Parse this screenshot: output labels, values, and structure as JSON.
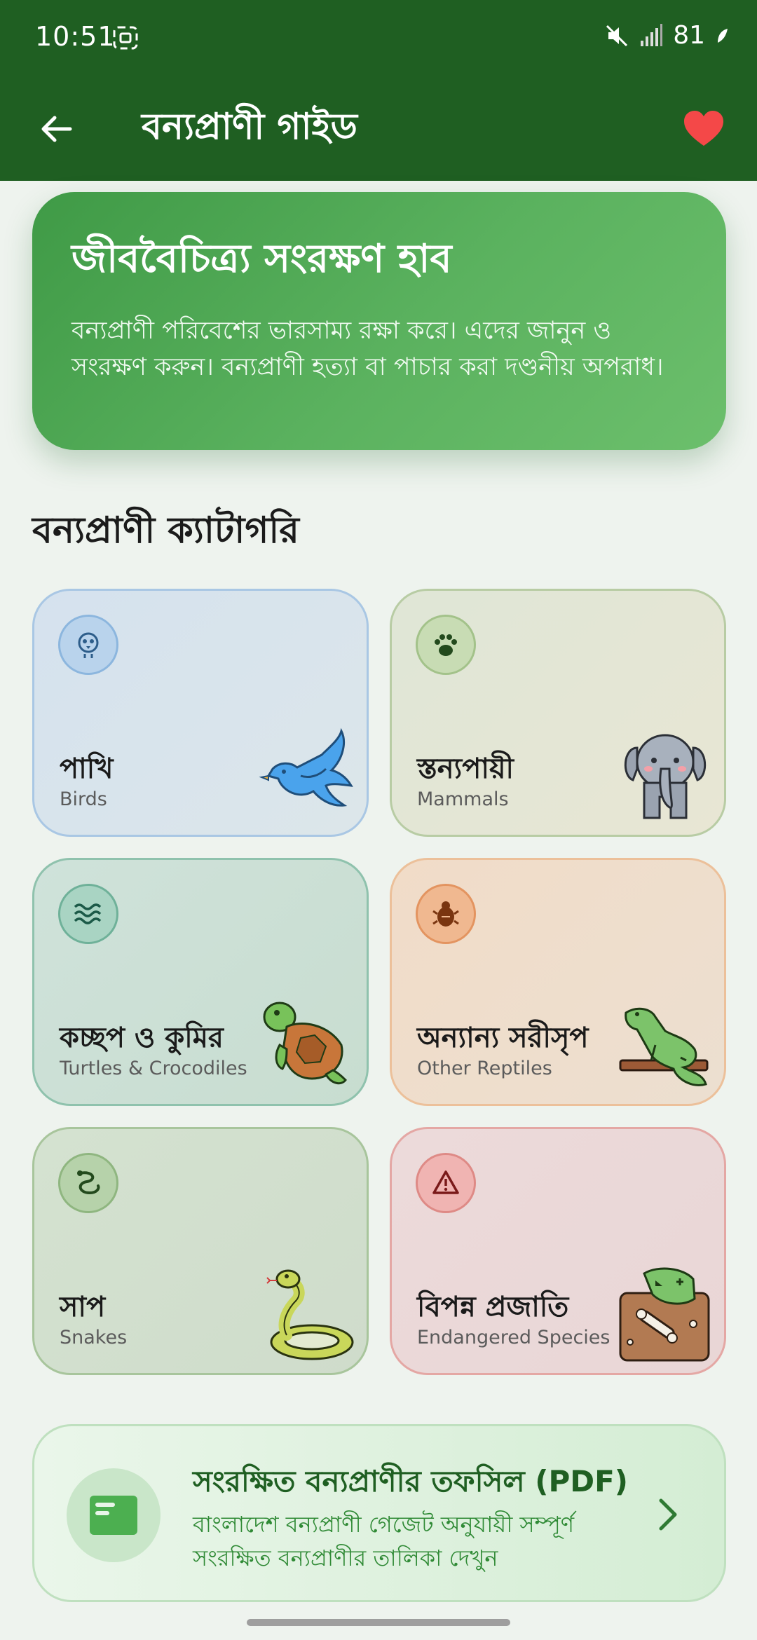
{
  "status_bar": {
    "time": "10:51",
    "battery": "81"
  },
  "app_bar": {
    "title": "বন্যপ্রাণী গাইড",
    "accent": "#1f5f22",
    "favorite_color": "#f44848"
  },
  "hero": {
    "title": "জীববৈচিত্র্য সংরক্ষণ হাব",
    "text": "বন্যপ্রাণী পরিবেশের ভারসাম্য রক্ষা করে। এদের জানুন ও সংরক্ষণ করুন। বন্যপ্রাণী হত্যা বা পাচার করা দণ্ডনীয় অপরাধ।"
  },
  "section_title": "বন্যপ্রাণী ক্যাটাগরি",
  "categories": [
    {
      "name": "পাখি",
      "sub": "Birds",
      "icon": "bird-icon",
      "illustration": "bird"
    },
    {
      "name": "স্তন্যপায়ী",
      "sub": "Mammals",
      "icon": "paw-icon",
      "illustration": "elephant"
    },
    {
      "name": "কচ্ছপ ও কুমির",
      "sub": "Turtles & Crocodiles",
      "icon": "waves-icon",
      "illustration": "turtle"
    },
    {
      "name": "অন্যান্য সরীসৃপ",
      "sub": "Other Reptiles",
      "icon": "bug-icon",
      "illustration": "lizard"
    },
    {
      "name": "সাপ",
      "sub": "Snakes",
      "icon": "snake-icon",
      "illustration": "snake"
    },
    {
      "name": "বিপন্ন প্রজাতি",
      "sub": "Endangered Species",
      "icon": "warning-icon",
      "illustration": "fossil"
    }
  ],
  "pdf_card": {
    "title": "সংরক্ষিত বন্যপ্রাণীর তফসিল (PDF)",
    "description": "বাংলাদেশ বন্যপ্রাণী গেজেট অনুযায়ী সম্পূর্ণ সংরক্ষিত বন্যপ্রাণীর তালিকা দেখুন"
  }
}
